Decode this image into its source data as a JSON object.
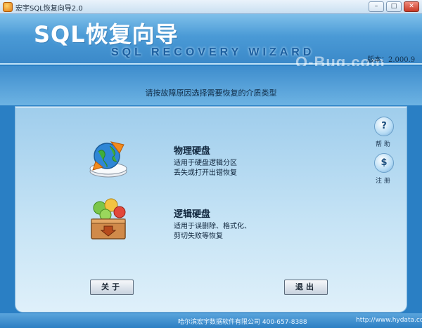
{
  "window": {
    "title": "宏宇SQL恢复向导2.0",
    "min": "–",
    "max": "□",
    "close": "✕"
  },
  "banner": {
    "title": "SQL恢复向导",
    "subtitle": "SQL RECOVERY WIZARD",
    "watermark": "Q-Bug.com",
    "version": "版本：2.000.9"
  },
  "instruction": "请按故障原因选择需要恢复的介质类型",
  "options": [
    {
      "title": "物理硬盘",
      "desc_line1": "适用于硬盘逻辑分区",
      "desc_line2": "丢失或打开出错恢复",
      "icon": "globe-recovery-icon"
    },
    {
      "title": "逻辑硬盘",
      "desc_line1": "适用于误删除、格式化、",
      "desc_line2": "剪切失败等恢复",
      "icon": "box-recovery-icon"
    }
  ],
  "side": {
    "help_symbol": "?",
    "help_label": "帮 助",
    "reg_symbol": "$",
    "reg_label": "注 册"
  },
  "buttons": {
    "about": "关于",
    "exit": "退出"
  },
  "footer": {
    "company": "哈尔滨宏宇数据软件有限公司  400-657-8388",
    "url": "http://www.hydata.com"
  },
  "colors": {
    "banner": "#4a9ad6",
    "panel": "#c5e3f5",
    "footer": "#2d7fc3"
  }
}
